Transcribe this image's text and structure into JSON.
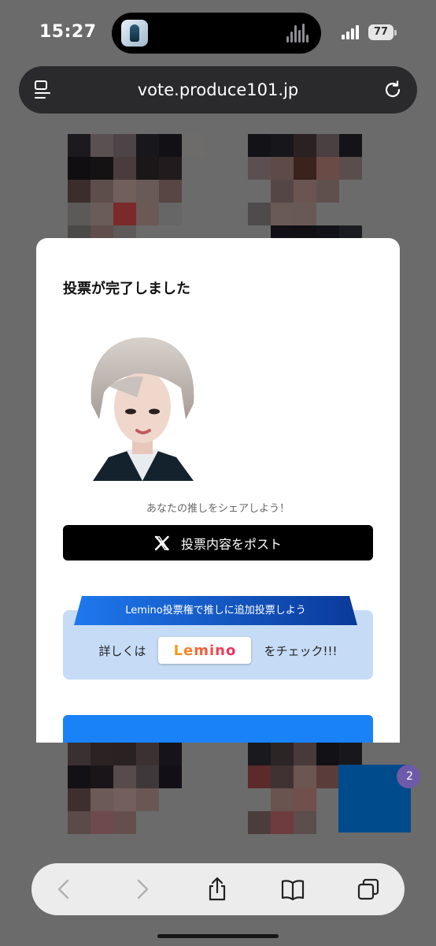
{
  "status_bar": {
    "time": "15:27",
    "battery": "77"
  },
  "browser": {
    "url": "vote.produce101.jp"
  },
  "modal": {
    "title": "投票が完了しました",
    "share_caption": "あなたの推しをシェアしよう！",
    "post_button_label": "投票内容をポスト",
    "lemino_banner": "Lemino投票権で推しに追加投票しよう",
    "lemino_prefix": "詳しくは",
    "lemino_logo": "Lemino",
    "lemino_suffix": "をチェック!!!"
  },
  "badge_count": "2",
  "colors": {
    "page_overlay": "#6b6b6b",
    "post_button": "#000000",
    "lemino_box": "#c6dcf6",
    "ribbon_start": "#1f78ee",
    "ribbon_end": "#0a3a9a",
    "cta": "#1a82f7"
  },
  "icons": {
    "address_left": "tabs-overview-icon",
    "address_right": "reload-icon",
    "toolbar": [
      "back-icon",
      "forward-icon",
      "share-icon",
      "bookmarks-icon",
      "tabs-icon"
    ]
  }
}
